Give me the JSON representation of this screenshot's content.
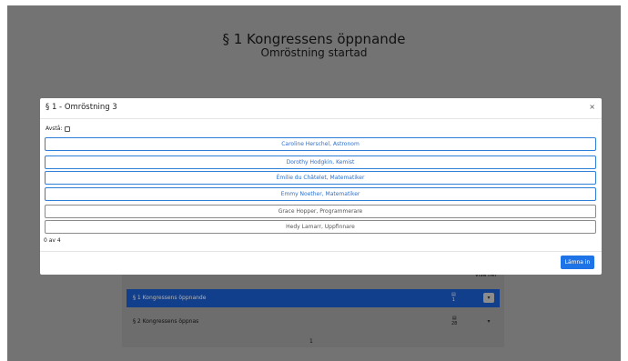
{
  "header": {
    "title": "§ 1 Kongressens öppnande",
    "subtitle": "Omröstning startad"
  },
  "agenda": {
    "show_more": "Visa fler",
    "items": [
      {
        "label": "§ 1 Kongressens öppnande",
        "count": "1"
      },
      {
        "label": "§ 2 Kongressens öppnas",
        "count": "28"
      }
    ],
    "pager": "1"
  },
  "modal": {
    "title": "§ 1 - Omröstning 3",
    "close": "×",
    "abstain_label": "Avstå:",
    "options": [
      {
        "label": "Caroline Herschel, Astronom",
        "selected": true
      },
      {
        "label": "Dorothy Hodgkin, Kemist",
        "selected": true
      },
      {
        "label": "Émilie du Châtelet, Matematiker",
        "selected": true
      },
      {
        "label": "Emmy Noether, Matematiker",
        "selected": true
      },
      {
        "label": "Grace Hopper, Programmerare",
        "selected": false
      },
      {
        "label": "Hedy Lamarr, Uppfinnare",
        "selected": false
      }
    ],
    "count_text": "0 av 4",
    "submit_label": "Lämna in"
  },
  "colors": {
    "overlay": "#737373",
    "primary": "#1e73e6",
    "option_border": "#2f7ed8",
    "active_row": "#123f8b"
  }
}
